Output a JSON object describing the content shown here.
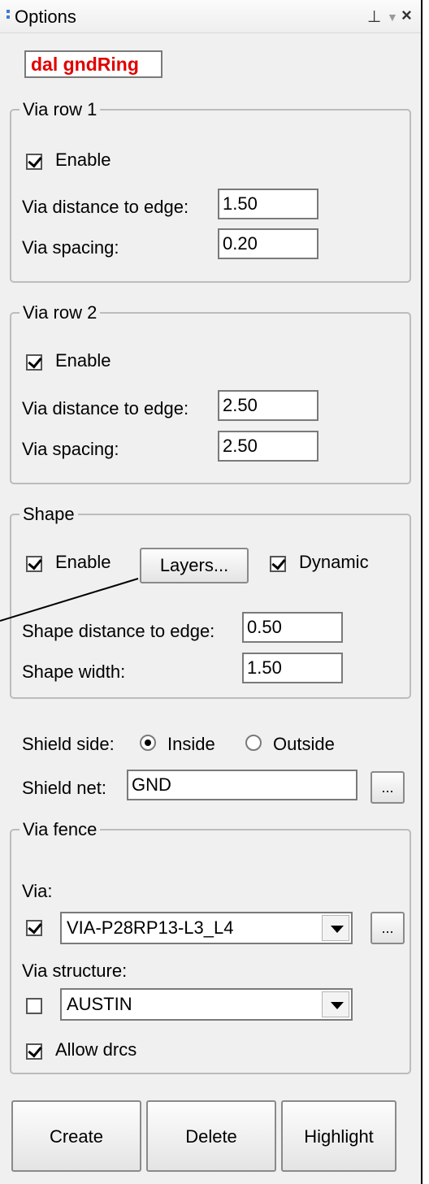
{
  "title": "Options",
  "titlebar": {
    "pin_icon": "pin-icon",
    "dropdown_icon": "dropdown-arrow-icon",
    "close_icon": "close-icon"
  },
  "design_name": "dal gndRing",
  "via_row_1": {
    "legend": "Via row 1",
    "enable_label": "Enable",
    "enable_checked": true,
    "distance_label": "Via distance to edge:",
    "distance_value": "1.50",
    "spacing_label": "Via spacing:",
    "spacing_value": "0.20"
  },
  "via_row_2": {
    "legend": "Via row 2",
    "enable_label": "Enable",
    "enable_checked": true,
    "distance_label": "Via distance to edge:",
    "distance_value": "2.50",
    "spacing_label": "Via spacing:",
    "spacing_value": "2.50"
  },
  "shape": {
    "legend": "Shape",
    "enable_label": "Enable",
    "enable_checked": true,
    "layers_button": "Layers...",
    "dynamic_label": "Dynamic",
    "dynamic_checked": true,
    "distance_label": "Shape distance to edge:",
    "distance_value": "0.50",
    "width_label": "Shape width:",
    "width_value": "1.50"
  },
  "shield": {
    "side_label": "Shield side:",
    "inside_label": "Inside",
    "outside_label": "Outside",
    "selected_side": "Inside",
    "net_label": "Shield net:",
    "net_value": "GND",
    "browse_button": "..."
  },
  "via_fence": {
    "legend": "Via fence",
    "via_label": "Via:",
    "via_checked": true,
    "via_value": "VIA-P28RP13-L3_L4",
    "via_browse_button": "...",
    "structure_label": "Via structure:",
    "structure_checked": false,
    "structure_value": "AUSTIN",
    "allow_drcs_label": "Allow drcs",
    "allow_drcs_checked": true
  },
  "buttons": {
    "create": "Create",
    "delete": "Delete",
    "highlight": "Highlight"
  }
}
